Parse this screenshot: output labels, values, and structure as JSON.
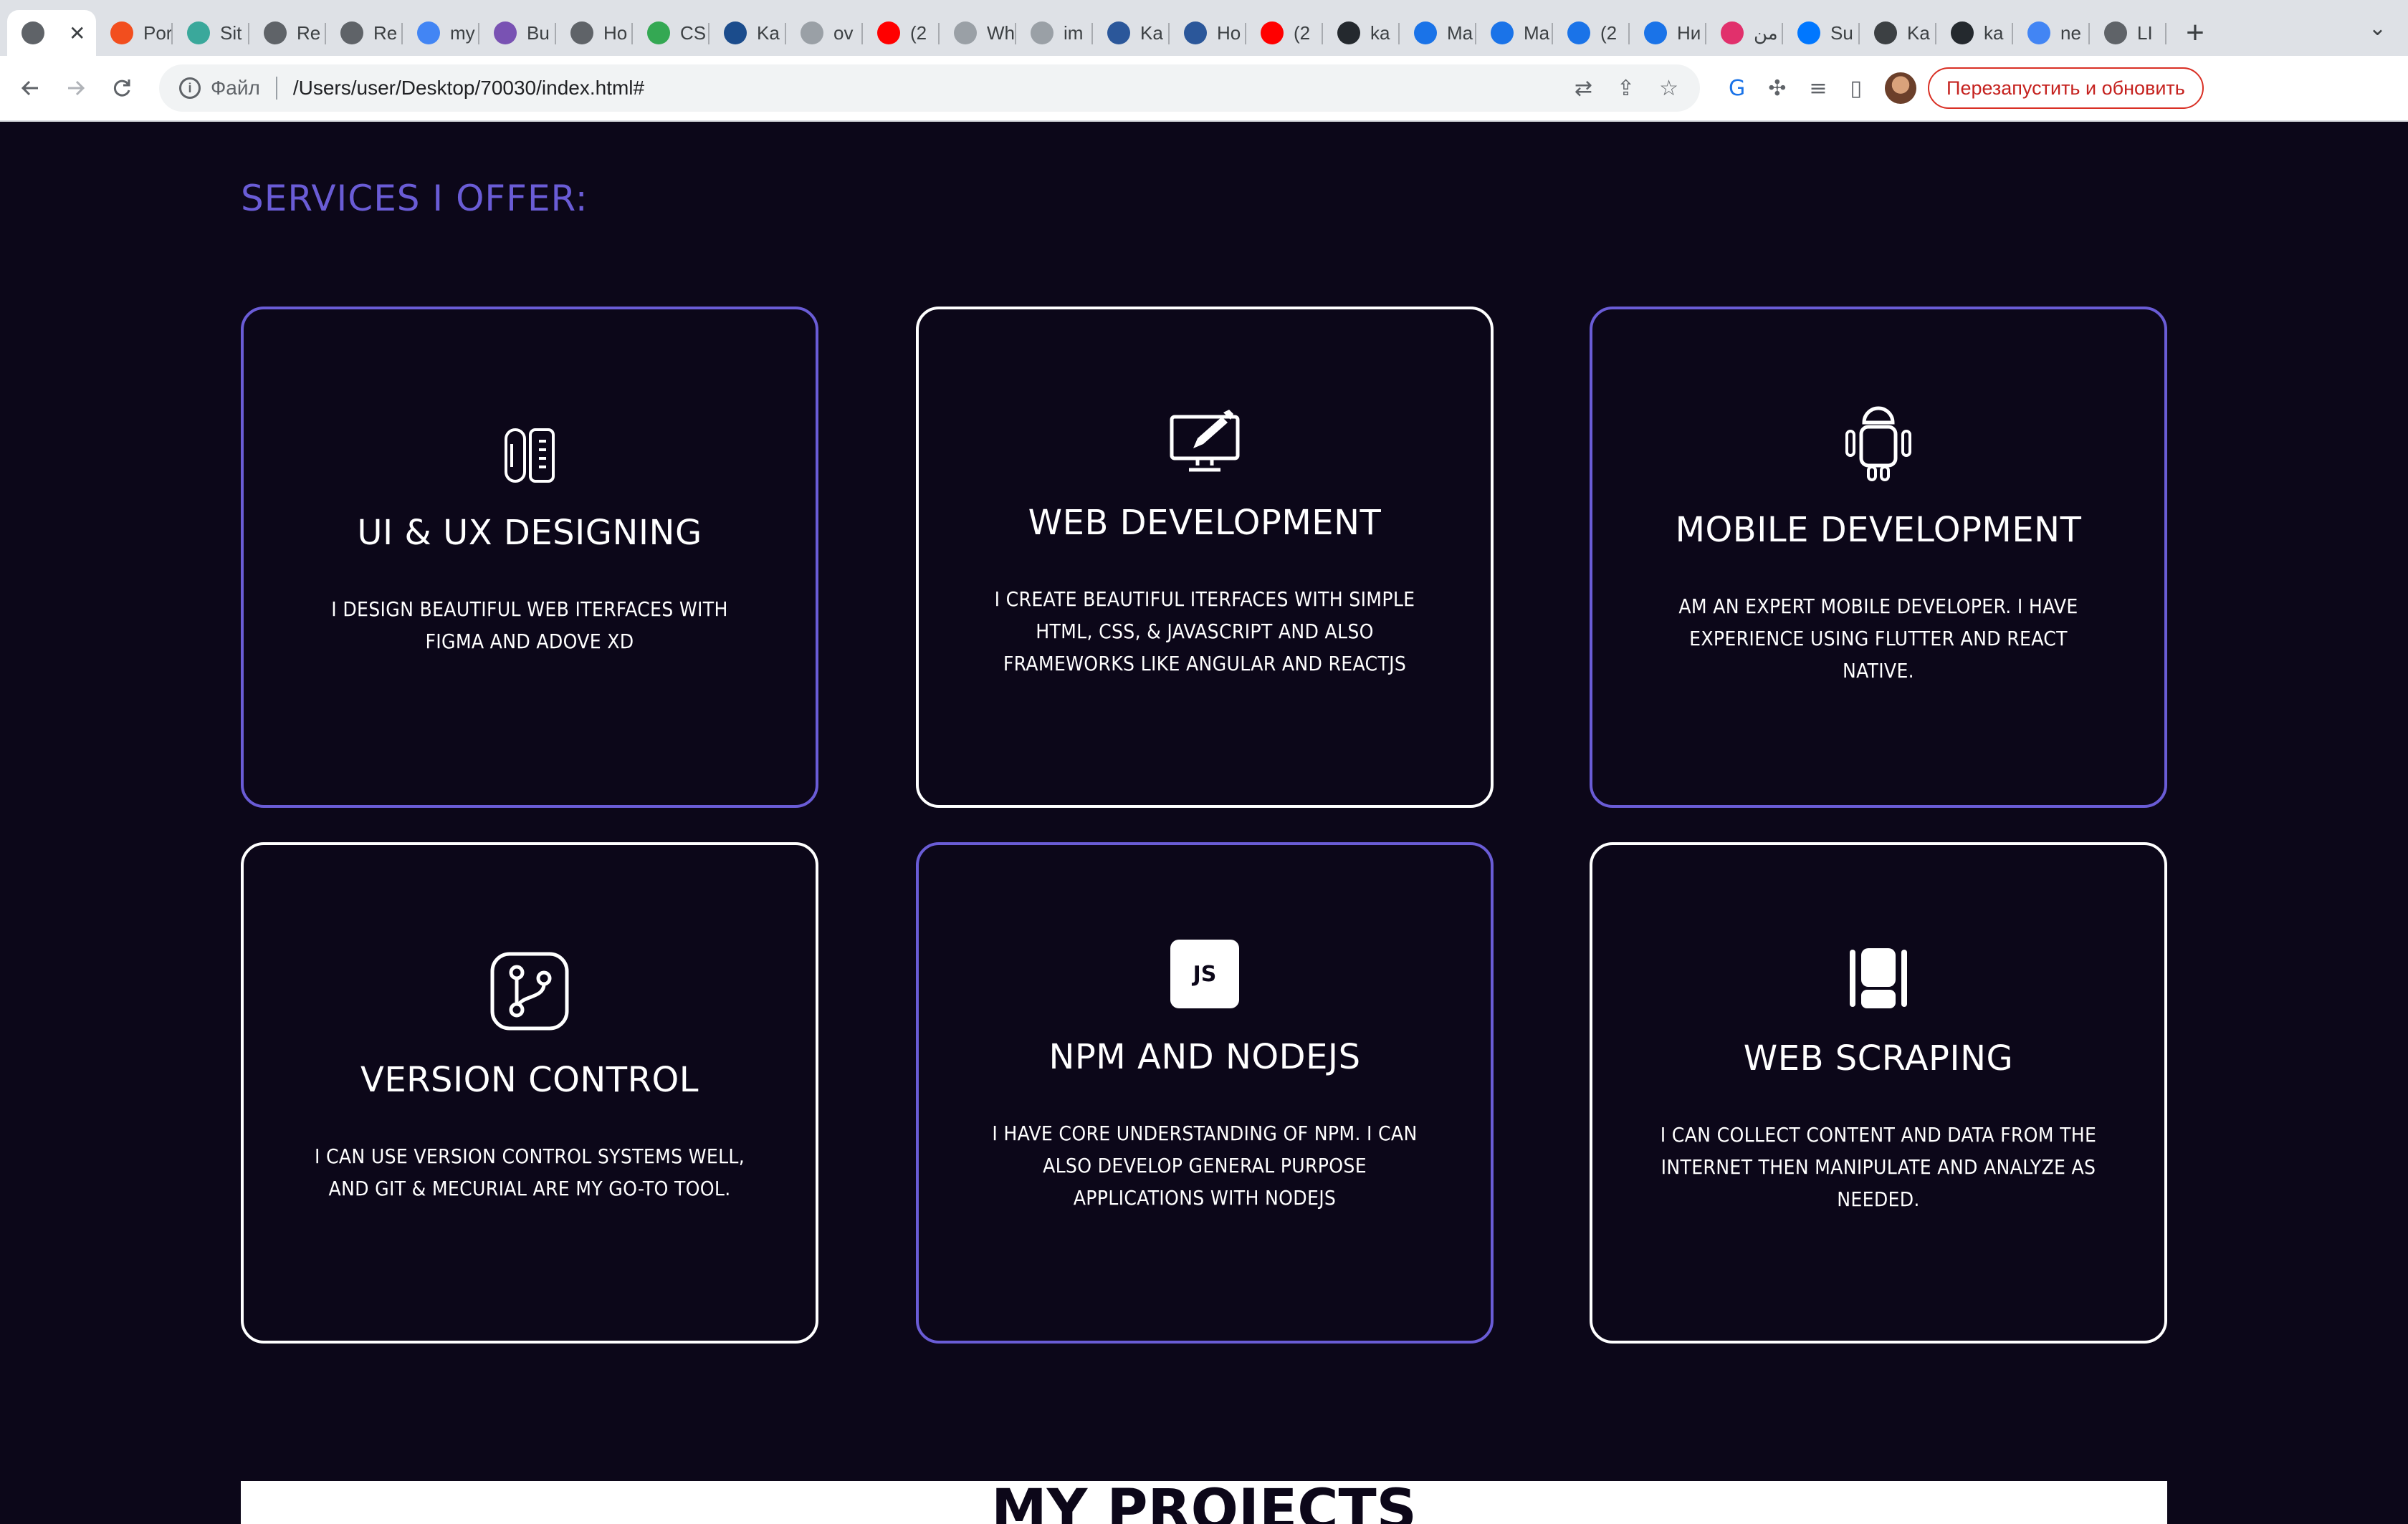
{
  "browser": {
    "tabs": [
      {
        "title": "",
        "favicon": "globe-icon",
        "color": "#5f6368",
        "active": true
      },
      {
        "title": "Por",
        "favicon": "figma-icon",
        "color": "#f24e1e"
      },
      {
        "title": "Sit",
        "favicon": "diamond-icon",
        "color": "#3aa89b"
      },
      {
        "title": "Re",
        "favicon": "globe-icon",
        "color": "#5f6368"
      },
      {
        "title": "Re",
        "favicon": "globe-icon",
        "color": "#5f6368"
      },
      {
        "title": "my",
        "favicon": "google-icon",
        "color": "#4285f4"
      },
      {
        "title": "Bu",
        "favicon": "bootstrap-icon",
        "color": "#7952b3"
      },
      {
        "title": "Ho",
        "favicon": "chrome-icon",
        "color": "#5f6368"
      },
      {
        "title": "CS",
        "favicon": "ws-icon",
        "color": "#34a853"
      },
      {
        "title": "Ka",
        "favicon": "stack-icon",
        "color": "#1b4c8c"
      },
      {
        "title": "ov",
        "favicon": "g-icon",
        "color": "#9aa0a6"
      },
      {
        "title": "(2",
        "favicon": "youtube-icon",
        "color": "#ff0000"
      },
      {
        "title": "Wh",
        "favicon": "spinner-icon",
        "color": "#9aa0a6"
      },
      {
        "title": "im",
        "favicon": "g-icon",
        "color": "#9aa0a6"
      },
      {
        "title": "Ka",
        "favicon": "wr-icon",
        "color": "#2b579a"
      },
      {
        "title": "Ho",
        "favicon": "wr-icon",
        "color": "#2b579a"
      },
      {
        "title": "(2",
        "favicon": "youtube-icon",
        "color": "#ff0000"
      },
      {
        "title": "ka",
        "favicon": "github-icon",
        "color": "#24292e"
      },
      {
        "title": "Ma",
        "favicon": "mail-icon",
        "color": "#1a73e8"
      },
      {
        "title": "Ma",
        "favicon": "mail-icon",
        "color": "#1a73e8"
      },
      {
        "title": "(2",
        "favicon": "envelope-icon",
        "color": "#1a73e8"
      },
      {
        "title": "Ни",
        "favicon": "mail-icon",
        "color": "#1a73e8"
      },
      {
        "title": "من",
        "favicon": "instagram-icon",
        "color": "#e1306c"
      },
      {
        "title": "Su",
        "favicon": "vk-icon",
        "color": "#0077ff"
      },
      {
        "title": "Ka",
        "favicon": "app-icon",
        "color": "#3c4043"
      },
      {
        "title": "ka",
        "favicon": "github-icon",
        "color": "#24292e"
      },
      {
        "title": "ne",
        "favicon": "google-icon",
        "color": "#4285f4"
      },
      {
        "title": "LI",
        "favicon": "globe-icon",
        "color": "#5f6368"
      }
    ],
    "address": {
      "scheme_label": "Файл",
      "url": "/Users/user/Desktop/70030/index.html#"
    },
    "relaunch_label": "Перезапустить и обновить"
  },
  "services": {
    "title": "SERVICES I OFFER:",
    "accent_color": "#6a5cd6",
    "cards": [
      {
        "icon": "ruler-pencil-icon",
        "title": "UI & UX DESIGNING",
        "text": "I DESIGN BEAUTIFUL WEB ITERFACES WITH FIGMA AND ADOVE XD",
        "accent": true
      },
      {
        "icon": "monitor-pen-icon",
        "title": "WEB DEVELOPMENT",
        "text": "I CREATE BEAUTIFUL ITERFACES WITH SIMPLE HTML, CSS, & JAVASCRIPT AND ALSO FRAMEWORKS LIKE ANGULAR AND REACTJS",
        "accent": false
      },
      {
        "icon": "android-icon",
        "title": "MOBILE DEVELOPMENT",
        "text": "AM AN EXPERT MOBILE DEVELOPER. I HAVE EXPERIENCE USING FLUTTER AND REACT NATIVE.",
        "accent": true
      },
      {
        "icon": "git-branch-icon",
        "title": "VERSION CONTROL",
        "text": "I CAN USE VERSION CONTROL SYSTEMS WELL, AND GIT & MECURIAL ARE MY GO-TO TOOL.",
        "accent": false
      },
      {
        "icon": "js-icon",
        "icon_text": "JS",
        "title": "NPM AND NODEJS",
        "text": "I HAVE CORE UNDERSTANDING OF NPM. I CAN ALSO DEVELOP GENERAL PURPOSE APPLICATIONS WITH NODEJS",
        "accent": true
      },
      {
        "icon": "scraper-icon",
        "title": "WEB SCRAPING",
        "text": "I CAN COLLECT CONTENT AND DATA FROM THE INTERNET THEN MANIPULATE AND ANALYZE AS NEEDED.",
        "accent": false
      }
    ]
  },
  "next_section": {
    "title": "MY PROJECTS"
  }
}
